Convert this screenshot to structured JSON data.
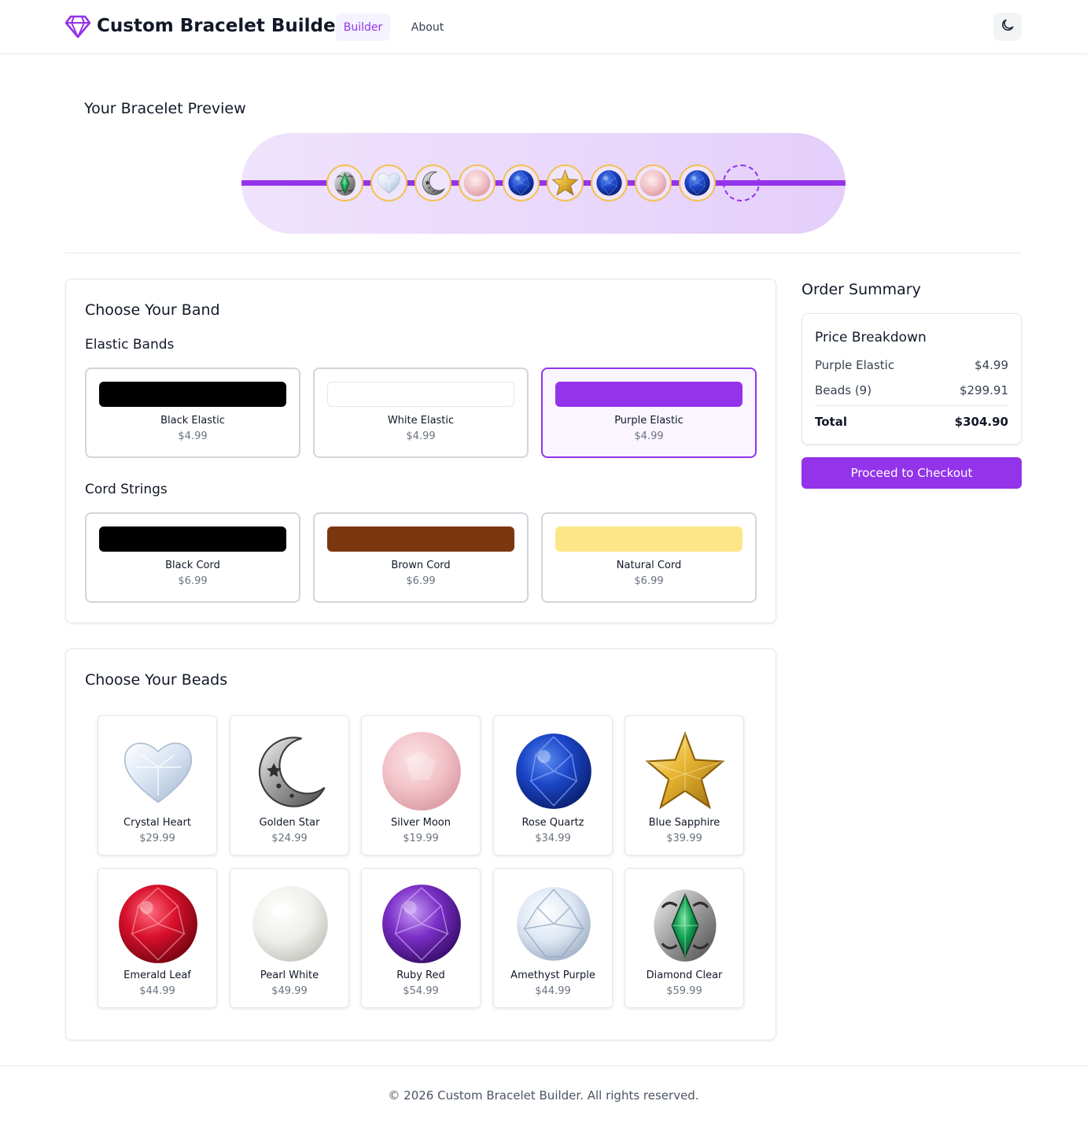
{
  "header": {
    "brand": "Custom Bracelet Builder",
    "logo_icon": "gem-icon",
    "nav": [
      {
        "label": "Builder",
        "active": true
      },
      {
        "label": "About",
        "active": false
      }
    ],
    "theme_icon": "moon-icon"
  },
  "preview": {
    "title": "Your Bracelet Preview",
    "band_color": "#9333ea",
    "slots": [
      "Diamond Clear",
      "Crystal Heart",
      "Golden Star",
      "Silver Moon",
      "Rose Quartz",
      "Blue Sapphire",
      "Rose Quartz",
      "Silver Moon",
      "Rose Quartz"
    ],
    "empty_slot": true
  },
  "bands": {
    "title": "Choose Your Band",
    "elastic_title": "Elastic Bands",
    "elastic": [
      {
        "name": "Black Elastic",
        "price": "$4.99",
        "color": "#000000",
        "selected": false
      },
      {
        "name": "White Elastic",
        "price": "$4.99",
        "color": "#ffffff",
        "selected": false
      },
      {
        "name": "Purple Elastic",
        "price": "$4.99",
        "color": "#9333ea",
        "selected": true
      }
    ],
    "cord_title": "Cord Strings",
    "cords": [
      {
        "name": "Black Cord",
        "price": "$6.99",
        "color": "#000000",
        "selected": false
      },
      {
        "name": "Brown Cord",
        "price": "$6.99",
        "color": "#7c3710",
        "selected": false
      },
      {
        "name": "Natural Cord",
        "price": "$6.99",
        "color": "#fde68a",
        "selected": false
      }
    ]
  },
  "beads": {
    "title": "Choose Your Beads",
    "items": [
      {
        "name": "Crystal Heart",
        "price": "$29.99",
        "icon": "crystal-heart"
      },
      {
        "name": "Golden Star",
        "price": "$24.99",
        "icon": "silver-moon"
      },
      {
        "name": "Silver Moon",
        "price": "$19.99",
        "icon": "rose-quartz"
      },
      {
        "name": "Rose Quartz",
        "price": "$34.99",
        "icon": "blue-sapphire"
      },
      {
        "name": "Blue Sapphire",
        "price": "$39.99",
        "icon": "golden-star"
      },
      {
        "name": "Emerald Leaf",
        "price": "$44.99",
        "icon": "ruby-red"
      },
      {
        "name": "Pearl White",
        "price": "$49.99",
        "icon": "pearl"
      },
      {
        "name": "Ruby Red",
        "price": "$54.99",
        "icon": "amethyst"
      },
      {
        "name": "Amethyst Purple",
        "price": "$44.99",
        "icon": "diamond"
      },
      {
        "name": "Diamond Clear",
        "price": "$59.99",
        "icon": "emerald"
      }
    ]
  },
  "summary": {
    "title": "Order Summary",
    "breakdown_title": "Price Breakdown",
    "rows": [
      {
        "label": "Purple Elastic",
        "value": "$4.99"
      },
      {
        "label": "Beads (9)",
        "value": "$299.91"
      }
    ],
    "total_label": "Total",
    "total_value": "$304.90",
    "checkout_label": "Proceed to Checkout"
  },
  "footer": {
    "text": "© 2026 Custom Bracelet Builder. All rights reserved."
  }
}
